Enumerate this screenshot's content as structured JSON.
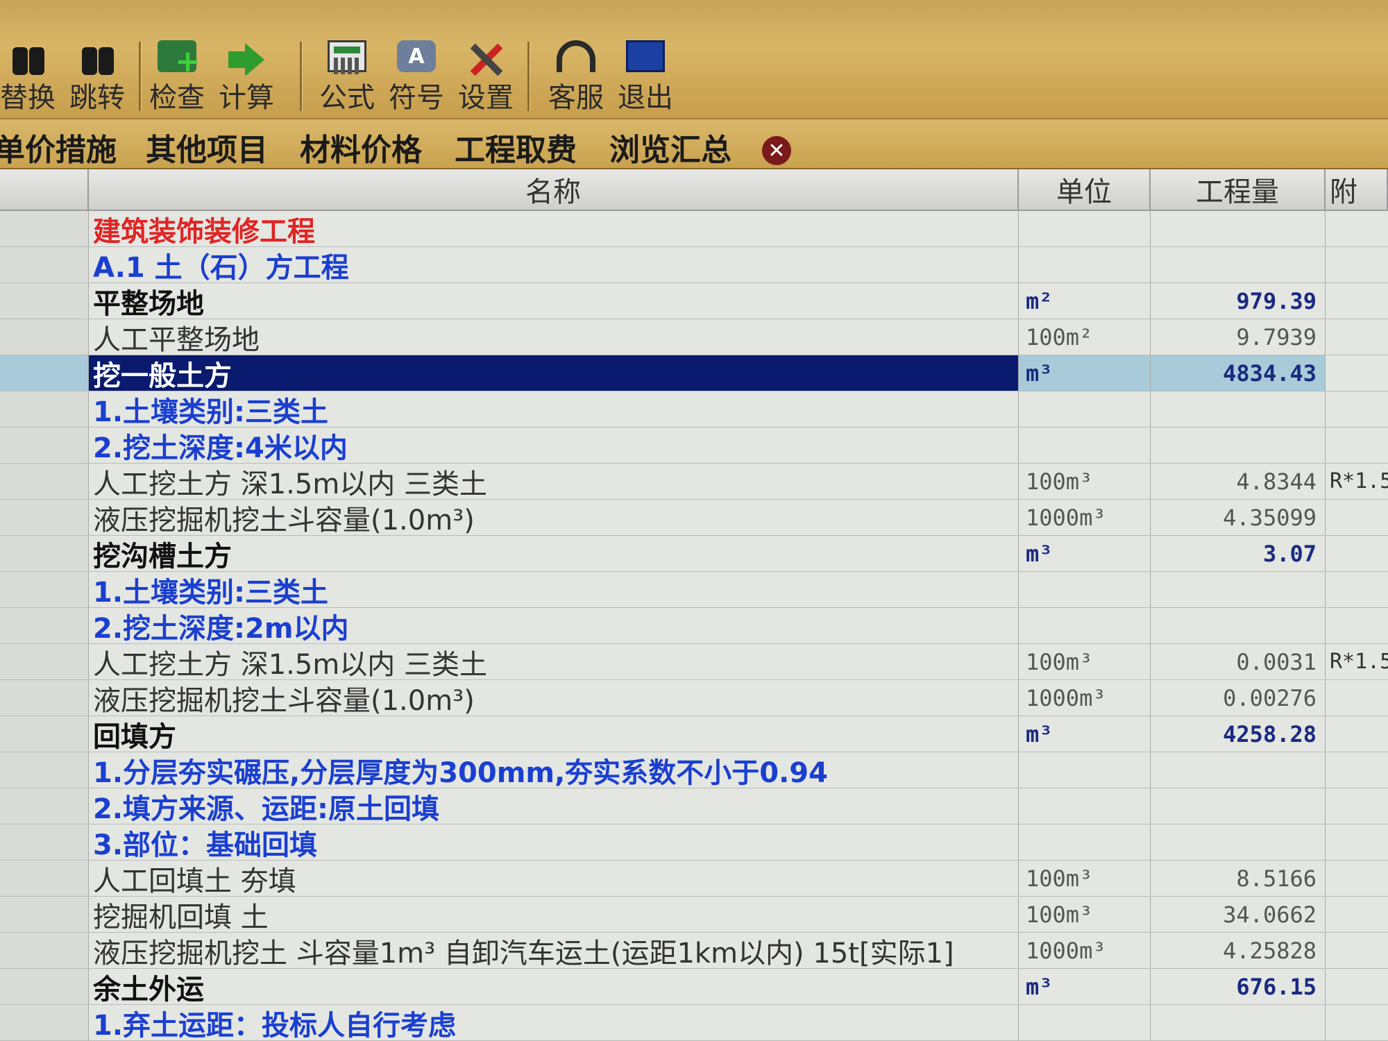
{
  "toolbar": {
    "buttons": [
      {
        "label": "替换",
        "icon": "binoculars-icon"
      },
      {
        "label": "跳转",
        "icon": "binoculars-icon"
      },
      {
        "label": "检查",
        "icon": "check-add-icon"
      },
      {
        "label": "计算",
        "icon": "green-arrow-icon"
      },
      {
        "label": "公式",
        "icon": "calculator-icon"
      },
      {
        "label": "符号",
        "icon": "symbol-icon"
      },
      {
        "label": "设置",
        "icon": "tools-icon"
      },
      {
        "label": "客服",
        "icon": "headset-icon"
      },
      {
        "label": "退出",
        "icon": "exit-icon"
      }
    ]
  },
  "tabs": [
    "单价措施",
    "其他项目",
    "材料价格",
    "工程取费",
    "浏览汇总"
  ],
  "tab_close_symbol": "✕",
  "grid": {
    "headers": {
      "name": "名称",
      "unit": "单位",
      "qty": "工程量",
      "extra": "附"
    },
    "rows": [
      {
        "type": "project",
        "name": "建筑装饰装修工程",
        "unit": "",
        "qty": "",
        "extra": ""
      },
      {
        "type": "chapter",
        "name": "A.1 土（石）方工程",
        "unit": "",
        "qty": "",
        "extra": ""
      },
      {
        "type": "item",
        "name": "平整场地",
        "unit": "m²",
        "qty": "979.39",
        "extra": ""
      },
      {
        "type": "quota",
        "name": "人工平整场地",
        "unit": "100m²",
        "qty": "9.7939",
        "extra": ""
      },
      {
        "type": "item",
        "name": "挖一般土方",
        "unit": "m³",
        "qty": "4834.43",
        "extra": "",
        "selected": true
      },
      {
        "type": "desc",
        "name": "1.土壤类别:三类土",
        "unit": "",
        "qty": "",
        "extra": ""
      },
      {
        "type": "desc",
        "name": "2.挖土深度:4米以内",
        "unit": "",
        "qty": "",
        "extra": ""
      },
      {
        "type": "quota",
        "name": "人工挖土方 深1.5m以内 三类土",
        "unit": "100m³",
        "qty": "4.8344",
        "extra": "R*1.5"
      },
      {
        "type": "quota",
        "name": "液压挖掘机挖土斗容量(1.0m³)",
        "unit": "1000m³",
        "qty": "4.35099",
        "extra": ""
      },
      {
        "type": "item",
        "name": "挖沟槽土方",
        "unit": "m³",
        "qty": "3.07",
        "extra": ""
      },
      {
        "type": "desc",
        "name": "1.土壤类别:三类土",
        "unit": "",
        "qty": "",
        "extra": ""
      },
      {
        "type": "desc",
        "name": "2.挖土深度:2m以内",
        "unit": "",
        "qty": "",
        "extra": ""
      },
      {
        "type": "quota",
        "name": "人工挖土方 深1.5m以内 三类土",
        "unit": "100m³",
        "qty": "0.0031",
        "extra": "R*1.5"
      },
      {
        "type": "quota",
        "name": "液压挖掘机挖土斗容量(1.0m³)",
        "unit": "1000m³",
        "qty": "0.00276",
        "extra": ""
      },
      {
        "type": "item",
        "name": "回填方",
        "unit": "m³",
        "qty": "4258.28",
        "extra": ""
      },
      {
        "type": "desc",
        "name": "1.分层夯实碾压,分层厚度为300mm,夯实系数不小于0.94",
        "unit": "",
        "qty": "",
        "extra": ""
      },
      {
        "type": "desc",
        "name": "2.填方来源、运距:原土回填",
        "unit": "",
        "qty": "",
        "extra": ""
      },
      {
        "type": "desc",
        "name": "3.部位：基础回填",
        "unit": "",
        "qty": "",
        "extra": ""
      },
      {
        "type": "quota",
        "name": "人工回填土 夯填",
        "unit": "100m³",
        "qty": "8.5166",
        "extra": ""
      },
      {
        "type": "quota",
        "name": "挖掘机回填 土",
        "unit": "100m³",
        "qty": "34.0662",
        "extra": ""
      },
      {
        "type": "quota",
        "name": "液压挖掘机挖土 斗容量1m³ 自卸汽车运土(运距1km以内) 15t[实际1]",
        "unit": "1000m³",
        "qty": "4.25828",
        "extra": ""
      },
      {
        "type": "item",
        "name": "余土外运",
        "unit": "m³",
        "qty": "676.15",
        "extra": ""
      },
      {
        "type": "desc",
        "name": "1.弃土运距：投标人自行考虑",
        "unit": "",
        "qty": "",
        "extra": ""
      }
    ]
  }
}
